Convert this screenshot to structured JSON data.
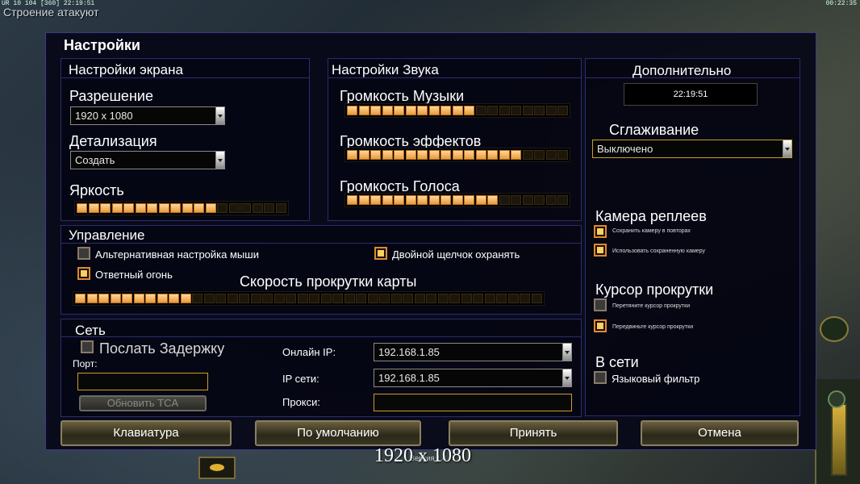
{
  "hud": {
    "top_left": "UR 10 104 [360] 22:19:51",
    "top_right": "00:22:35",
    "alert": "Строение атакуют"
  },
  "dialog": {
    "title": "Настройки",
    "screen": {
      "title": "Настройки экрана",
      "resolution_label": "Разрешение",
      "resolution_value": "1920 x 1080",
      "detail_label": "Детализация",
      "detail_value": "Создать",
      "brightness_label": "Яркость",
      "brightness_level": 0.67
    },
    "sound": {
      "title": "Настройки Звука",
      "music_label": "Громкость Музыки",
      "music_level": 0.58,
      "effects_label": "Громкость эффектов",
      "effects_level": 0.8,
      "voice_label": "Громкость Голоса",
      "voice_level": 0.7
    },
    "extra": {
      "title": "Дополнительно",
      "clock": "22:19:51",
      "antialias_label": "Сглаживание",
      "antialias_value": "Выключено",
      "replay_title": "Камера реплеев",
      "replay_save": "Сохранить камеру в повторах",
      "replay_use": "Использовать сохраненную камеру",
      "cursor_title": "Курсор прокрутки",
      "cursor_opt1": "Перетяните курсор прокрутки",
      "cursor_opt2": "Передвиньте курсор прокрутки",
      "online_title": "В сети",
      "language_filter": "Языковый фильтр"
    },
    "control": {
      "title": "Управление",
      "alt_mouse": "Альтернативная настройка мыши",
      "double_click": "Двойной щелчок охранять",
      "return_fire": "Ответный огонь",
      "scroll_speed_label": "Скорость прокрутки карты",
      "scroll_speed_level": 0.25
    },
    "network": {
      "title": "Сеть",
      "send_delay": "Послать Задержку",
      "port_label": "Порт:",
      "update_tca": "Обновить TCA",
      "online_ip_label": "Онлайн IP:",
      "online_ip_value": "192.168.1.85",
      "lan_ip_label": "IP сети:",
      "lan_ip_value": "192.168.1.85",
      "proxy_label": "Прокси:"
    },
    "buttons": {
      "keyboard": "Клавиатура",
      "defaults": "По умолчанию",
      "accept": "Принять",
      "cancel": "Отмена"
    },
    "version": "Версия 1.4"
  },
  "overlay_resolution": "1920 x 1080"
}
